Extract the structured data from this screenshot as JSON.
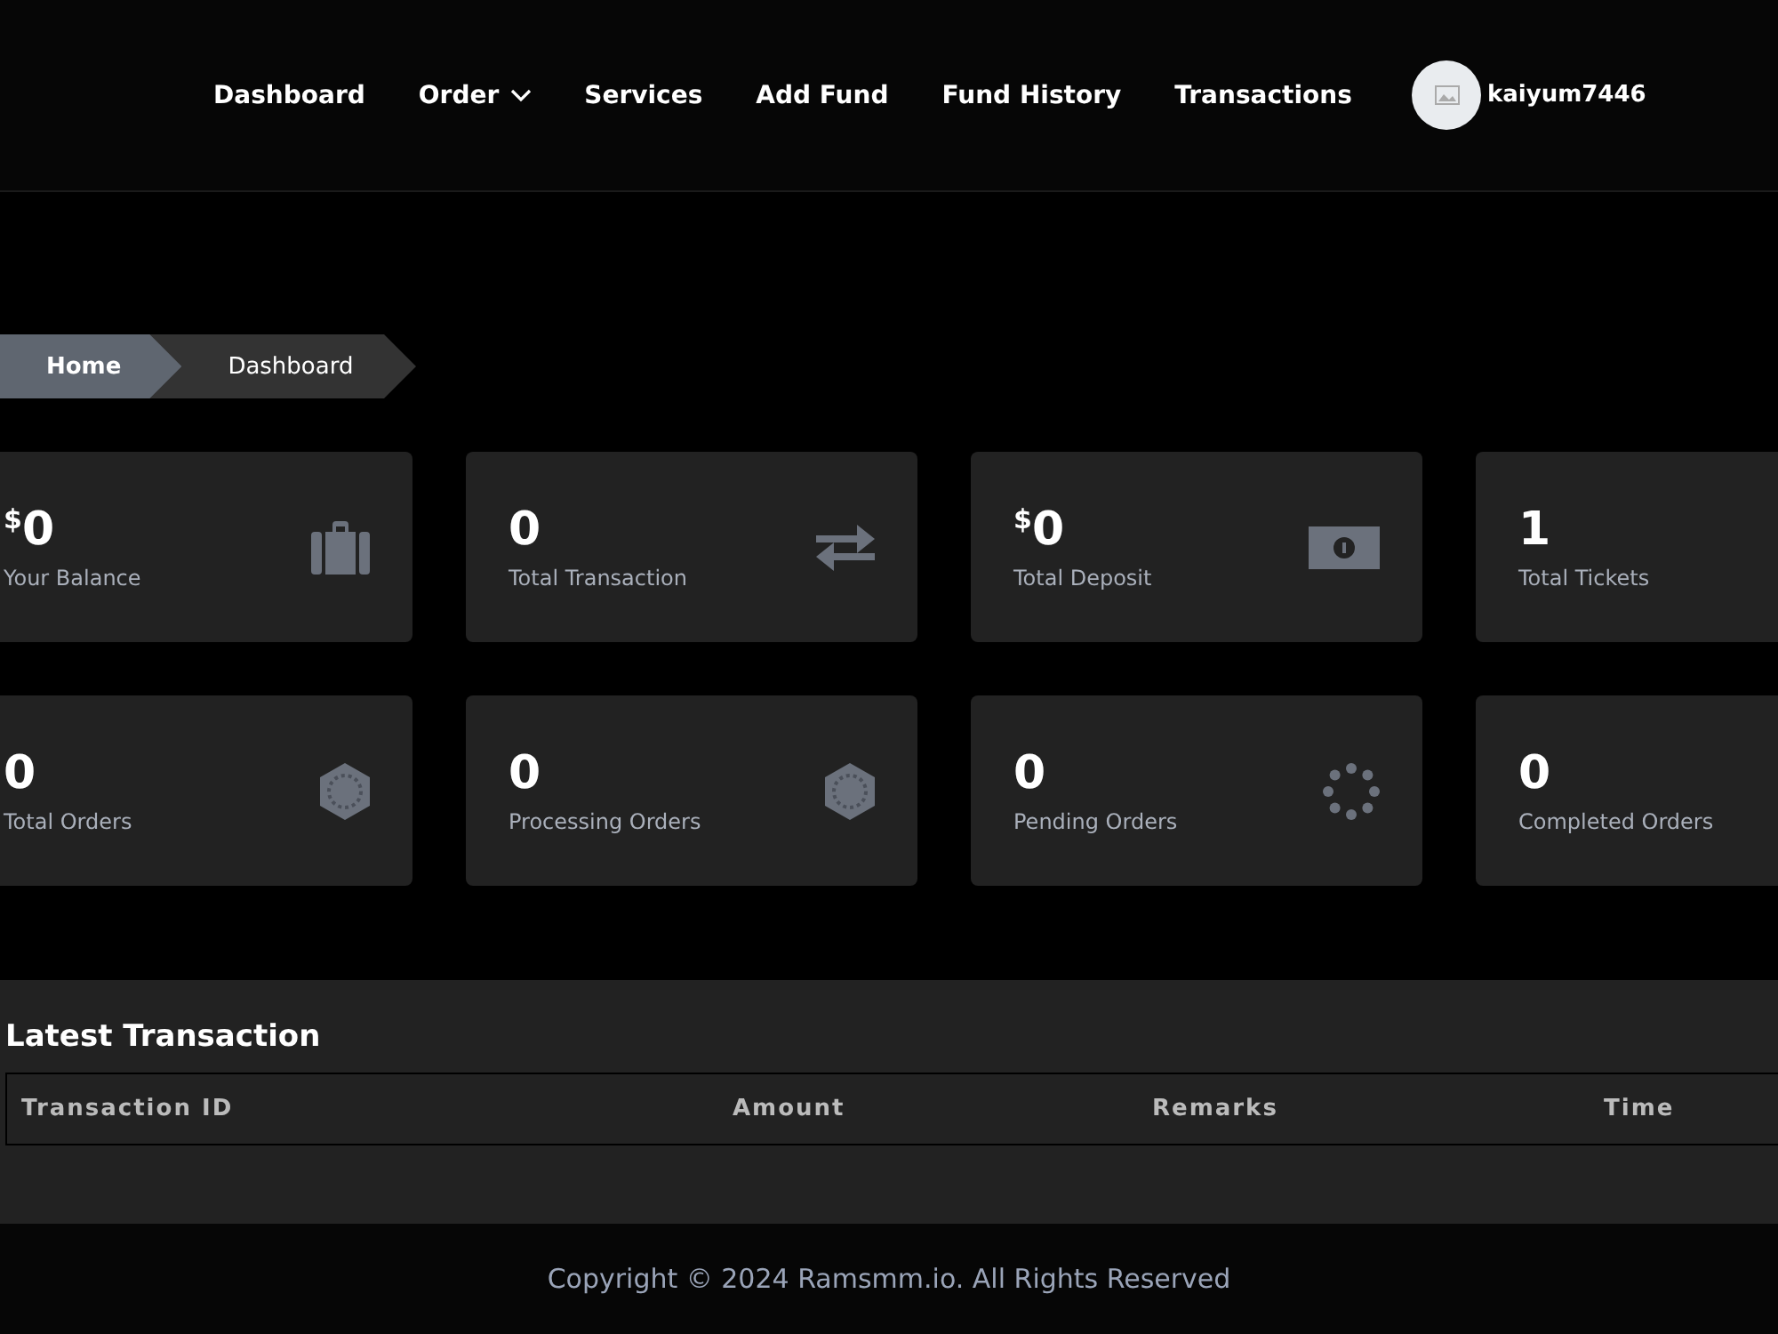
{
  "nav": {
    "items": [
      {
        "label": "Dashboard",
        "dropdown": false
      },
      {
        "label": "Order",
        "dropdown": true
      },
      {
        "label": "Services",
        "dropdown": false
      },
      {
        "label": "Add Fund",
        "dropdown": false
      },
      {
        "label": "Fund History",
        "dropdown": false
      },
      {
        "label": "Transactions",
        "dropdown": false
      }
    ],
    "user": {
      "name": "kaiyum7446"
    }
  },
  "breadcrumb": [
    {
      "label": "Home",
      "selected": true
    },
    {
      "label": "Dashboard",
      "selected": false
    }
  ],
  "cards": [
    {
      "currency": "$",
      "value": "0",
      "label": "Your Balance"
    },
    {
      "value": "0",
      "label": "Total Transaction"
    },
    {
      "currency": "$",
      "value": "0",
      "label": "Total Deposit"
    },
    {
      "value": "1",
      "label": "Total Tickets"
    },
    {
      "value": "0",
      "label": "Total Orders"
    },
    {
      "value": "0",
      "label": "Processing Orders"
    },
    {
      "value": "0",
      "label": "Pending Orders"
    },
    {
      "value": "0",
      "label": "Completed Orders"
    }
  ],
  "latest_transaction": {
    "title": "Latest Transaction",
    "columns": [
      "Transaction ID",
      "Amount",
      "Remarks",
      "Time"
    ]
  },
  "footer": {
    "text": "Copyright © 2024 Ramsmm.io. All Rights Reserved"
  }
}
